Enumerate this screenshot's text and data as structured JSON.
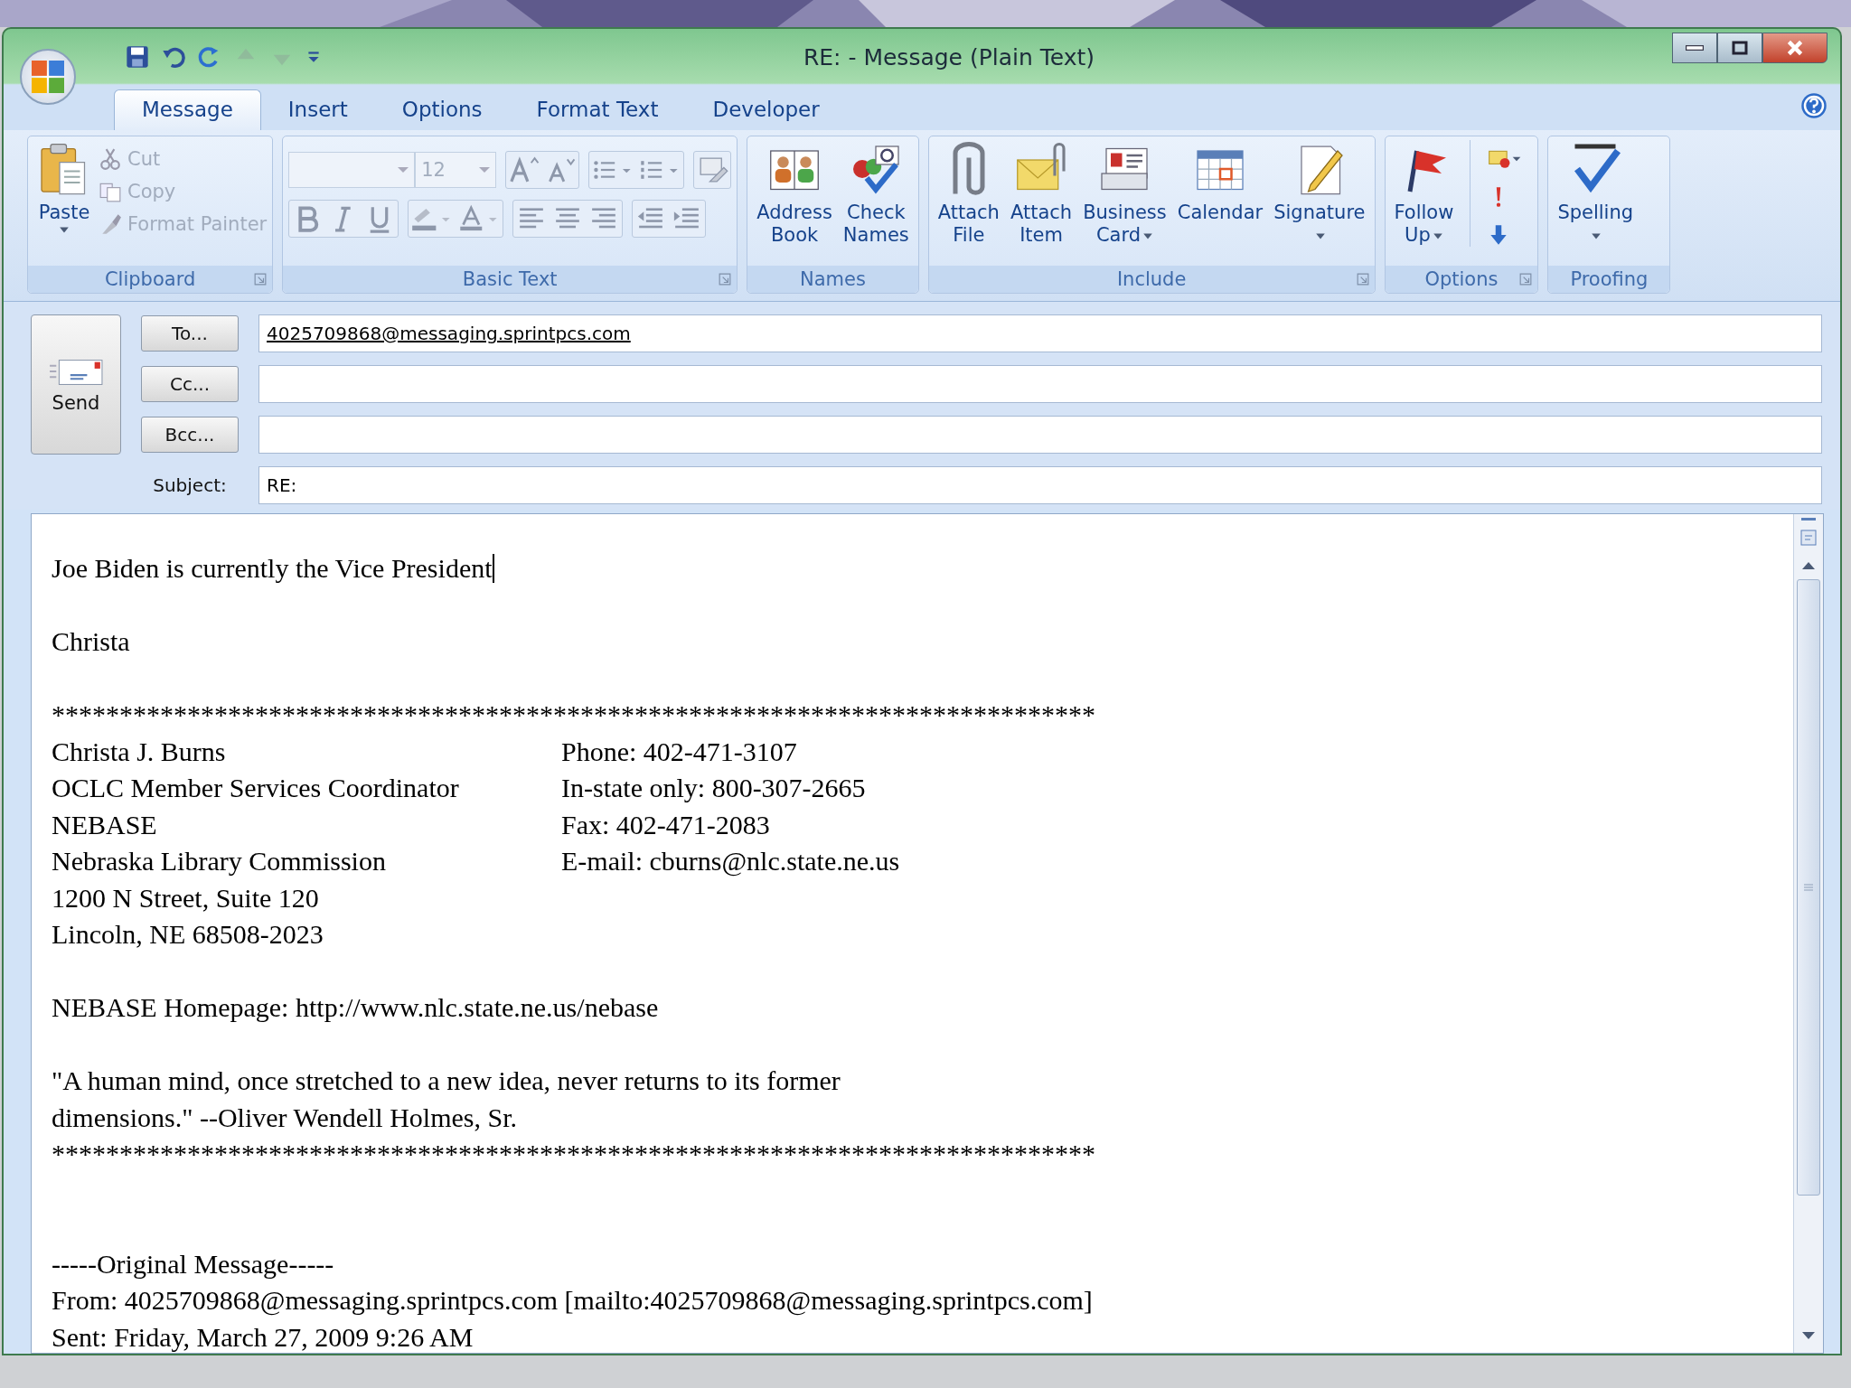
{
  "window": {
    "title": "RE:  - Message (Plain Text)"
  },
  "tabs": [
    {
      "label": "Message",
      "selected": true
    },
    {
      "label": "Insert",
      "selected": false
    },
    {
      "label": "Options",
      "selected": false
    },
    {
      "label": "Format Text",
      "selected": false
    },
    {
      "label": "Developer",
      "selected": false
    }
  ],
  "ribbon": [
    {
      "kind": "clipboard",
      "label": "Clipboard",
      "launcher": true,
      "buttons": [
        {
          "kind": "paste",
          "label": "Paste",
          "caret": true,
          "disabled": false
        }
      ],
      "small": [
        {
          "kind": "cut",
          "label": "Cut",
          "disabled": true
        },
        {
          "kind": "copy",
          "label": "Copy",
          "disabled": true
        },
        {
          "kind": "format-painter",
          "label": "Format Painter",
          "disabled": true
        }
      ]
    },
    {
      "kind": "basic_text",
      "label": "Basic Text",
      "launcher": true,
      "font_size": "12"
    },
    {
      "kind": "standard",
      "label": "Names",
      "launcher": false,
      "buttons": [
        {
          "kind": "address-book",
          "label": "Address Book",
          "caret": false
        },
        {
          "kind": "check-names",
          "label": "Check Names",
          "caret": false
        }
      ]
    },
    {
      "kind": "standard",
      "label": "Include",
      "launcher": true,
      "buttons": [
        {
          "kind": "attach-file",
          "label": "Attach File",
          "caret": false
        },
        {
          "kind": "attach-item",
          "label": "Attach Item",
          "caret": false
        },
        {
          "kind": "business-card",
          "label": "Business Card",
          "caret": true
        },
        {
          "kind": "calendar",
          "label": "Calendar",
          "caret": false
        },
        {
          "kind": "signature",
          "label": "Signature",
          "caret": true
        }
      ]
    },
    {
      "kind": "options",
      "label": "Options",
      "launcher": true,
      "buttons": [
        {
          "kind": "follow-up",
          "label": "Follow Up",
          "caret": true
        }
      ]
    },
    {
      "kind": "standard",
      "label": "Proofing",
      "launcher": false,
      "buttons": [
        {
          "kind": "spelling",
          "label": "Spelling",
          "caret": true
        }
      ]
    }
  ],
  "header": {
    "send": "Send",
    "recipients": [
      {
        "button": "To...",
        "value": "4025709868@messaging.sprintpcs.com"
      },
      {
        "button": "Cc..."
      },
      {
        "button": "Bcc..."
      }
    ],
    "subject": {
      "label": "Subject:",
      "value": "RE:"
    }
  },
  "body": [
    {
      "kind": "line",
      "text": "Joe Biden is currently the Vice President",
      "cursor": true
    },
    {
      "kind": "blank"
    },
    {
      "kind": "line",
      "text": "Christa",
      "cursor": false
    },
    {
      "kind": "blank"
    },
    {
      "kind": "line",
      "text": "*****************************************************************************",
      "cursor": false
    },
    {
      "kind": "columns",
      "left": "Christa J. Burns",
      "right": "Phone: 402-471-3107"
    },
    {
      "kind": "columns",
      "left": "OCLC Member Services Coordinator",
      "right": "In-state only: 800-307-2665"
    },
    {
      "kind": "columns",
      "left": "NEBASE",
      "right": "Fax: 402-471-2083"
    },
    {
      "kind": "columns",
      "left": "Nebraska Library Commission",
      "right": "E-mail: cburns@nlc.state.ne.us"
    },
    {
      "kind": "line",
      "text": "1200 N Street, Suite 120",
      "cursor": false
    },
    {
      "kind": "line",
      "text": "Lincoln, NE 68508-2023",
      "cursor": false
    },
    {
      "kind": "blank"
    },
    {
      "kind": "line",
      "text": "NEBASE Homepage: http://www.nlc.state.ne.us/nebase",
      "cursor": false
    },
    {
      "kind": "blank"
    },
    {
      "kind": "line",
      "text": "\"A human mind, once stretched to a new idea, never returns to its former",
      "cursor": false
    },
    {
      "kind": "line",
      "text": "dimensions.\" --Oliver Wendell Holmes, Sr.",
      "cursor": false
    },
    {
      "kind": "line",
      "text": "*****************************************************************************",
      "cursor": false
    },
    {
      "kind": "blank"
    },
    {
      "kind": "blank"
    },
    {
      "kind": "line",
      "text": "-----Original Message-----",
      "cursor": false
    },
    {
      "kind": "line",
      "text": "From: 4025709868@messaging.sprintpcs.com [mailto:4025709868@messaging.sprintpcs.com]",
      "cursor": false
    },
    {
      "kind": "line",
      "text": "Sent: Friday, March 27, 2009 9:26 AM",
      "cursor": false
    }
  ]
}
